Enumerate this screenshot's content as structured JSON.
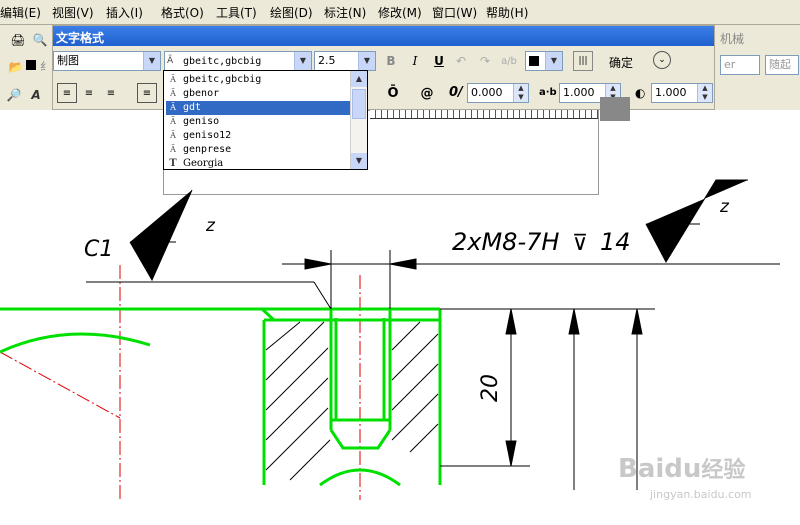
{
  "menu": [
    "编辑(E)",
    "视图(V)",
    "插入(I)",
    "格式(O)",
    "工具(T)",
    "绘图(D)",
    "标注(N)",
    "修改(M)",
    "窗口(W)",
    "帮助(H)"
  ],
  "text_format": {
    "title": "文字格式",
    "style_value": "制图",
    "font_value": "gbeitc,gbcbig",
    "height_value": "2.5",
    "bold": "B",
    "italic": "I",
    "underline": "U",
    "ok_label": "确定",
    "oblique_value": "0.000",
    "tracking_label": "a·b",
    "tracking_value": "1.000",
    "width_value": "1.000"
  },
  "right_toolbar": {
    "panel_label": "机械",
    "combo_partial": "er",
    "combo2_partial": "随起"
  },
  "left_toolbar": {
    "partial": "纟"
  },
  "font_list": {
    "items": [
      "gbeitc,gbcbig",
      "gbenor",
      "gdt",
      "geniso",
      "geniso12",
      "genprese",
      "Georgia"
    ],
    "selected_index": 2
  },
  "drawing": {
    "chamfer_label": "C1",
    "roughness_left": "z",
    "roughness_right": "z",
    "thread_note": "2xM8-7H",
    "depth_symbol": "⊽",
    "depth_value": "14",
    "vertical_dim": "20",
    "colors": {
      "outline": "#00E000",
      "centerline": "#E00000",
      "dims": "#000000"
    }
  },
  "watermark": {
    "brand": "Baidu",
    "brand_cn": "经验",
    "url": "jingyan.baidu.com"
  }
}
